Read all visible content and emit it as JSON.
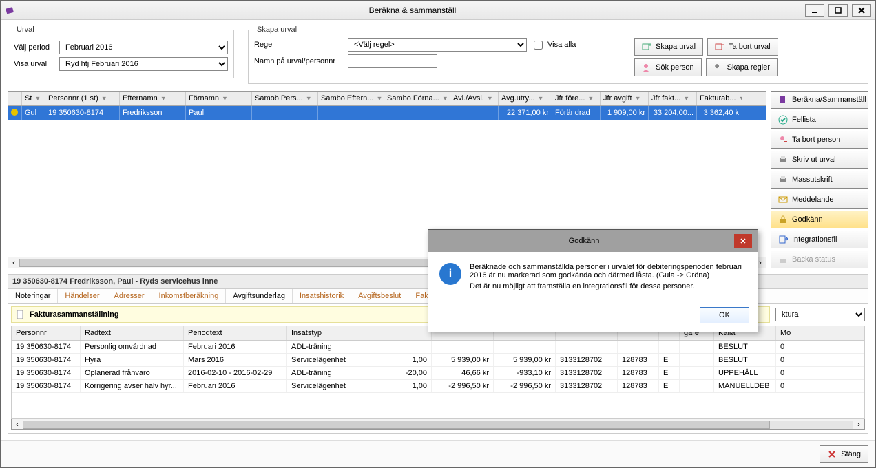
{
  "window": {
    "title": "Beräkna & sammanställ",
    "close_btn": "Stäng"
  },
  "urval": {
    "legend": "Urval",
    "valj_period_label": "Välj period",
    "valj_period_value": "Februari 2016",
    "visa_urval_label": "Visa urval",
    "visa_urval_value": "Ryd htj Februari 2016"
  },
  "skapa": {
    "legend": "Skapa urval",
    "regel_label": "Regel",
    "regel_value": "<Välj regel>",
    "namn_label": "Namn på urval/personnr",
    "visa_alla_label": "Visa alla",
    "skapa_urval_btn": "Skapa urval",
    "ta_bort_urval_btn": "Ta bort urval",
    "sok_person_btn": "Sök person",
    "skapa_regler_btn": "Skapa regler"
  },
  "grid": {
    "columns": [
      "",
      "St",
      "Personnr (1 st)",
      "Efternamn",
      "Förnamn",
      "Samob Pers...",
      "Sambo Eftern...",
      "Sambo Förna...",
      "Avl./Avsl.",
      "Avg.utry...",
      "Jfr före...",
      "Jfr avgift",
      "Jfr fakt...",
      "Fakturab..."
    ],
    "row": {
      "st": "Gul",
      "personnr": "19 350630-8174",
      "efternamn": "Fredriksson",
      "fornamn": "Paul",
      "samob": "",
      "samboE": "",
      "samboF": "",
      "avl": "",
      "avgutry": "22 371,00 kr",
      "jfrfore": "Förändrad",
      "jfravgift": "1 909,00 kr",
      "jfrfakt": "33 204,00...",
      "fakturab": "3 362,40 k"
    }
  },
  "side": {
    "berakna": "Beräkna/Sammanställ",
    "fellista": "Fellista",
    "ta_bort_person": "Ta bort person",
    "skriv_ut_urval": "Skriv ut urval",
    "massutskrift": "Massutskrift",
    "meddelande": "Meddelande",
    "godkann": "Godkänn",
    "integrationsfil": "Integrationsfil",
    "backa_status": "Backa status"
  },
  "detail": {
    "header": "19 350630-8174 Fredriksson, Paul  -  Ryds servicehus inne",
    "tabs": [
      "Noteringar",
      "Händelser",
      "Adresser",
      "Inkomstberäkning",
      "Avgiftsunderlag",
      "Insatshistorik",
      "Avgiftsbeslut",
      "Fakturasa..."
    ],
    "section_title": "Fakturasammanställning",
    "right_select": "ktura",
    "columns": [
      "Personnr",
      "Radtext",
      "Periodtext",
      "Insatstyp",
      "",
      "",
      "",
      "",
      "",
      "",
      "gare",
      "Källa",
      "Mo"
    ],
    "rows": [
      {
        "p": "19 350630-8174",
        "r": "Personlig omvårdnad",
        "pe": "Februari 2016",
        "i": "ADL-träning",
        "c5": "",
        "c6": "",
        "c7": "",
        "c8": "",
        "c9": "",
        "c10": "",
        "g": "",
        "k": "BESLUT",
        "m": "0"
      },
      {
        "p": "19 350630-8174",
        "r": "Hyra",
        "pe": "Mars 2016",
        "i": "Servicelägenhet",
        "c5": "1,00",
        "c6": "5 939,00 kr",
        "c7": "5 939,00 kr",
        "c8": "3133128702",
        "c9": "128783",
        "c10": "E",
        "g": "",
        "k": "BESLUT",
        "m": "0"
      },
      {
        "p": "19 350630-8174",
        "r": "Oplanerad frånvaro",
        "pe": "2016-02-10 - 2016-02-29",
        "i": "ADL-träning",
        "c5": "-20,00",
        "c6": "46,66 kr",
        "c7": "-933,10 kr",
        "c8": "3133128702",
        "c9": "128783",
        "c10": "E",
        "g": "",
        "k": "UPPEHÅLL",
        "m": "0"
      },
      {
        "p": "19 350630-8174",
        "r": "Korrigering avser halv hyr...",
        "pe": "Februari 2016",
        "i": "Servicelägenhet",
        "c5": "1,00",
        "c6": "-2 996,50 kr",
        "c7": "-2 996,50 kr",
        "c8": "3133128702",
        "c9": "128783",
        "c10": "E",
        "g": "",
        "k": "MANUELLDEB",
        "m": "0"
      }
    ]
  },
  "modal": {
    "title": "Godkänn",
    "line1": "Beräknade och sammanställda personer i urvalet för debiteringsperioden februari 2016 är nu markerad som godkända och därmed låsta. (Gula -> Gröna)",
    "line2": "Det är nu möjligt att framställa en integrationsfil för dessa personer.",
    "ok": "OK"
  }
}
